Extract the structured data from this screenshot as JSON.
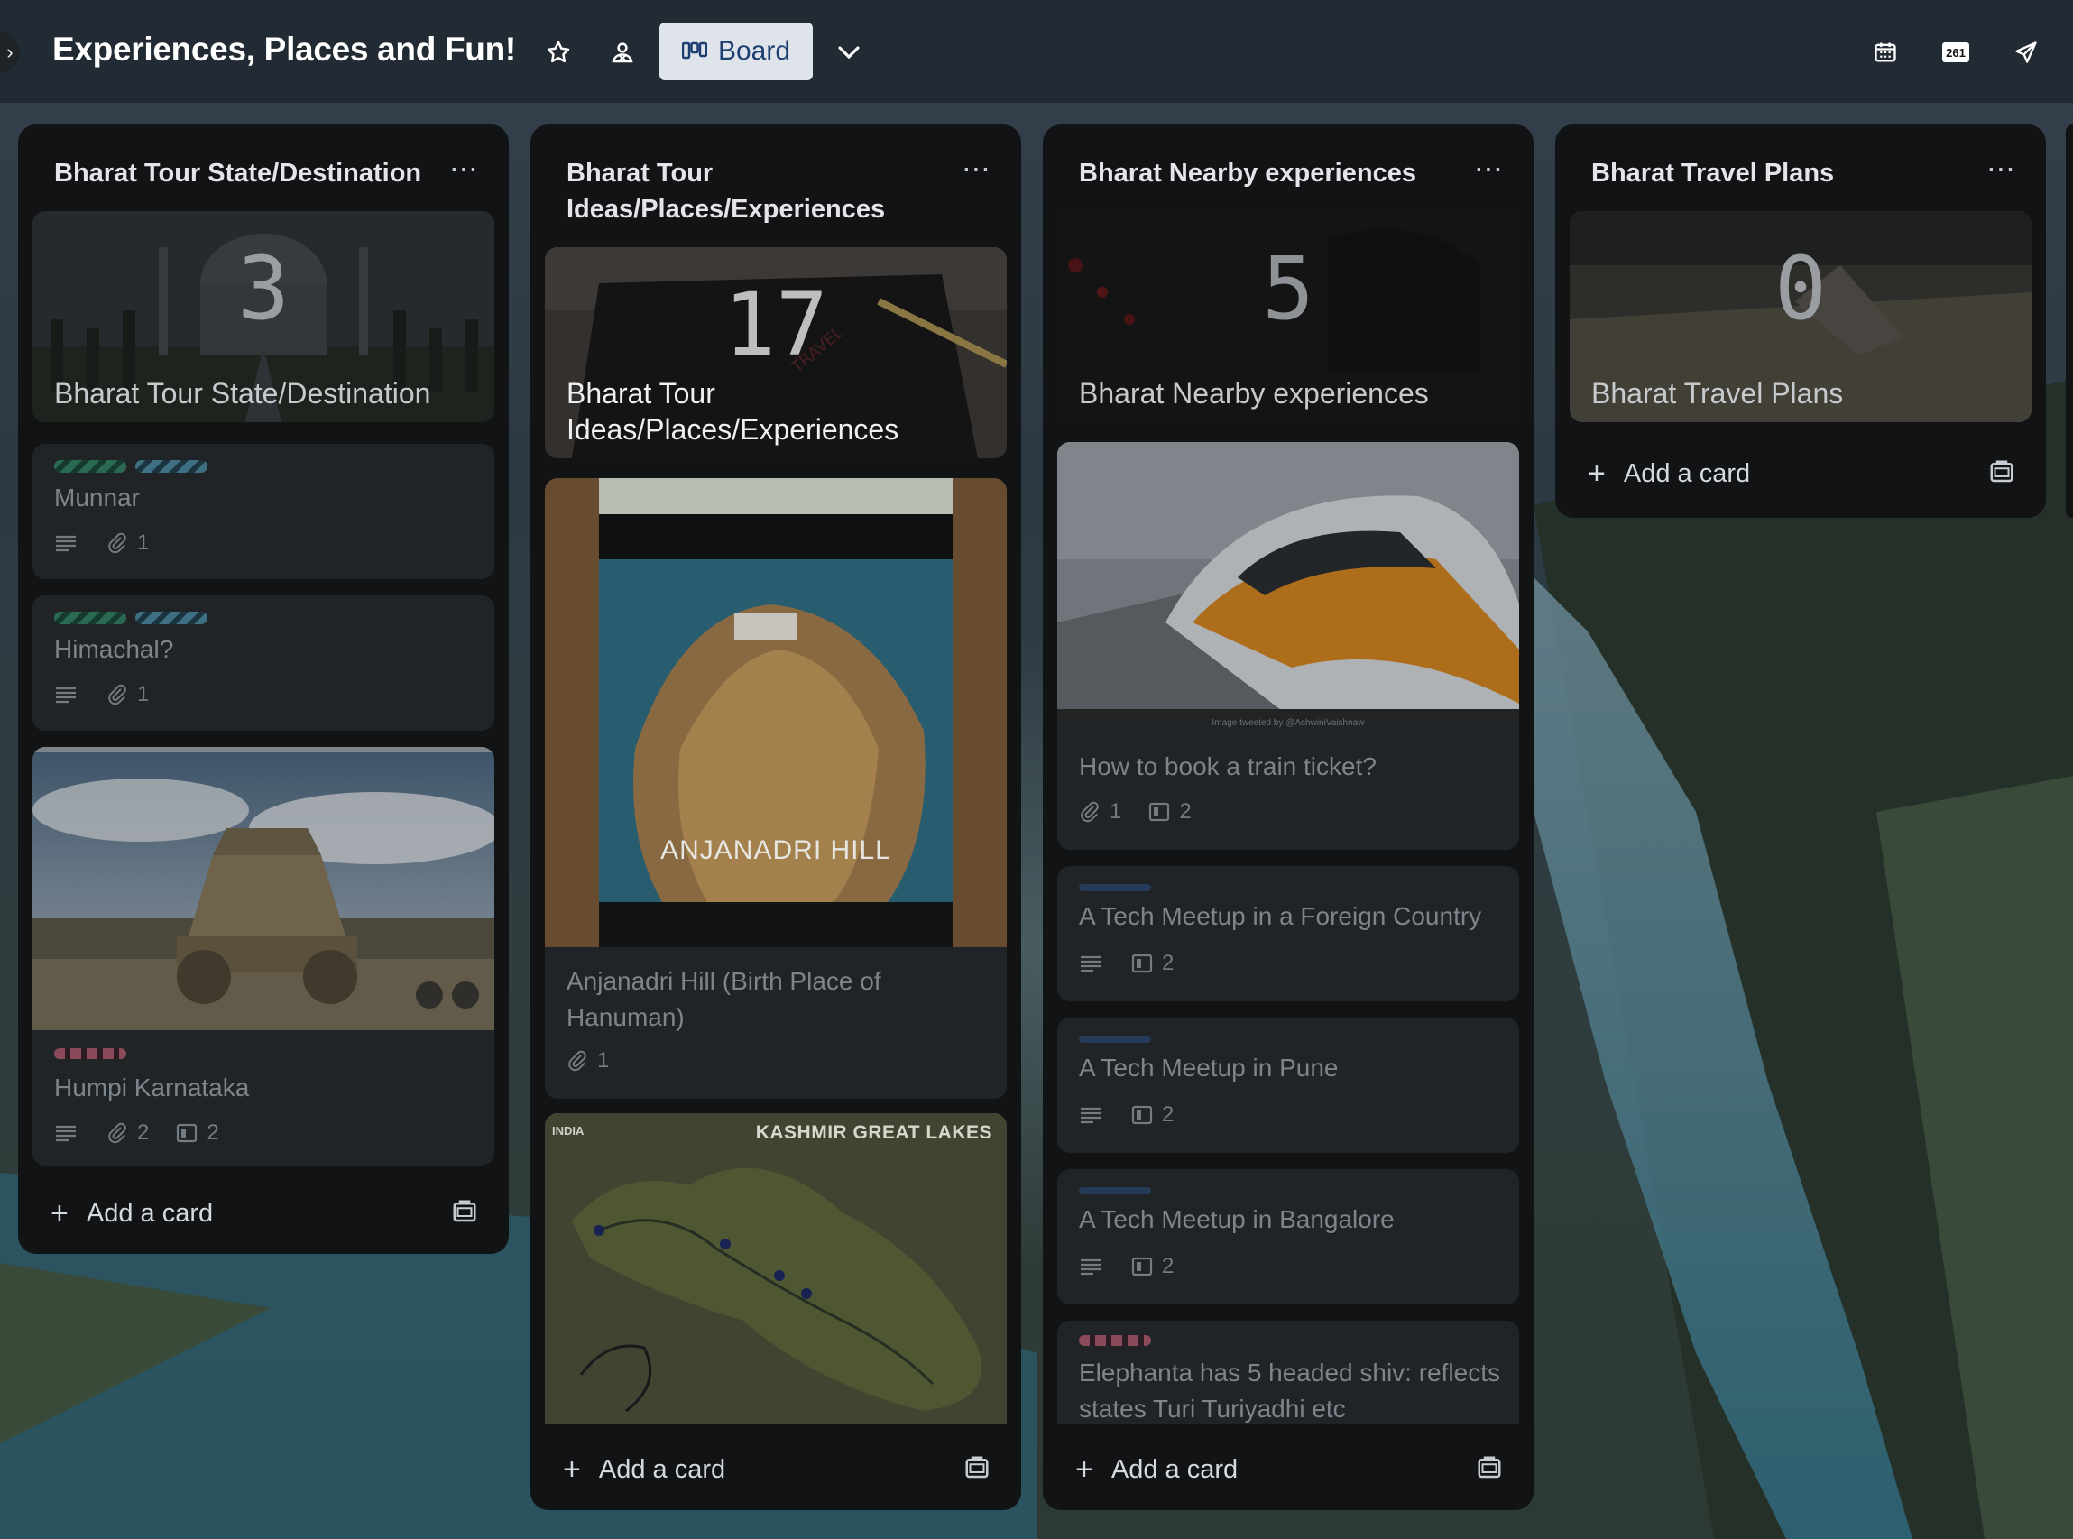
{
  "board": {
    "title": "Experiences, Places and Fun!",
    "view_label": "Board"
  },
  "header_icons": [
    "chevron-right-icon",
    "star-icon",
    "workspace-visibility-icon",
    "board-view-icon",
    "chevron-down-icon",
    "calendar-icon",
    "power-up-261-icon",
    "send-icon"
  ],
  "header_power_up_badge": "261",
  "lists": [
    {
      "title": "Bharat Tour State/Destination",
      "cover_count": "3",
      "cover_title": "Bharat Tour State/Destination",
      "cards": [
        {
          "title": "Munnar",
          "attachments": "1"
        },
        {
          "title": "Himachal?",
          "attachments": "1"
        },
        {
          "title": "Humpi Karnataka",
          "attachments": "2",
          "checklist": "2"
        }
      ],
      "add_label": "Add a card"
    },
    {
      "title": "Bharat Tour Ideas/Places/Experiences",
      "cover_count": "17",
      "cover_title": "Bharat Tour Ideas/Places/Experiences",
      "cards": [
        {
          "title": "Anjanadri Hill (Birth Place of Hanuman)",
          "attachments": "1",
          "image_caption": "ANJANADRI HILL"
        },
        {
          "title": "",
          "image_header_left": "INDIA",
          "image_header_right": "KASHMIR GREAT LAKES"
        }
      ],
      "add_label": "Add a card"
    },
    {
      "title": "Bharat Nearby experiences",
      "cover_count": "5",
      "cover_title": "Bharat Nearby experiences",
      "cards": [
        {
          "title": "How to book a train ticket?",
          "attachments": "1",
          "checklist": "2",
          "image_credit": "Image tweeted by @AshwiniVaishnaw"
        },
        {
          "title": "A Tech Meetup in a Foreign Country",
          "checklist": "2"
        },
        {
          "title": "A Tech Meetup in Pune",
          "checklist": "2"
        },
        {
          "title": "A Tech Meetup in Bangalore",
          "checklist": "2"
        },
        {
          "title": "Elephanta has 5 headed shiv: reflects states Turi Turiyadhi etc"
        }
      ],
      "add_label": "Add a card"
    },
    {
      "title": "Bharat Travel Plans",
      "cover_count": "0",
      "cover_title": "Bharat Travel Plans",
      "cards": [],
      "add_label": "Add a card"
    }
  ],
  "colors": {
    "list_bg": "#111315",
    "card_bg": "#212426",
    "board_button_bg": "#dfe3ea",
    "label_green": "#2a6a52",
    "label_teal": "#3f6f83",
    "label_pink": "#8a4a5a",
    "label_navy": "#263a5a"
  }
}
